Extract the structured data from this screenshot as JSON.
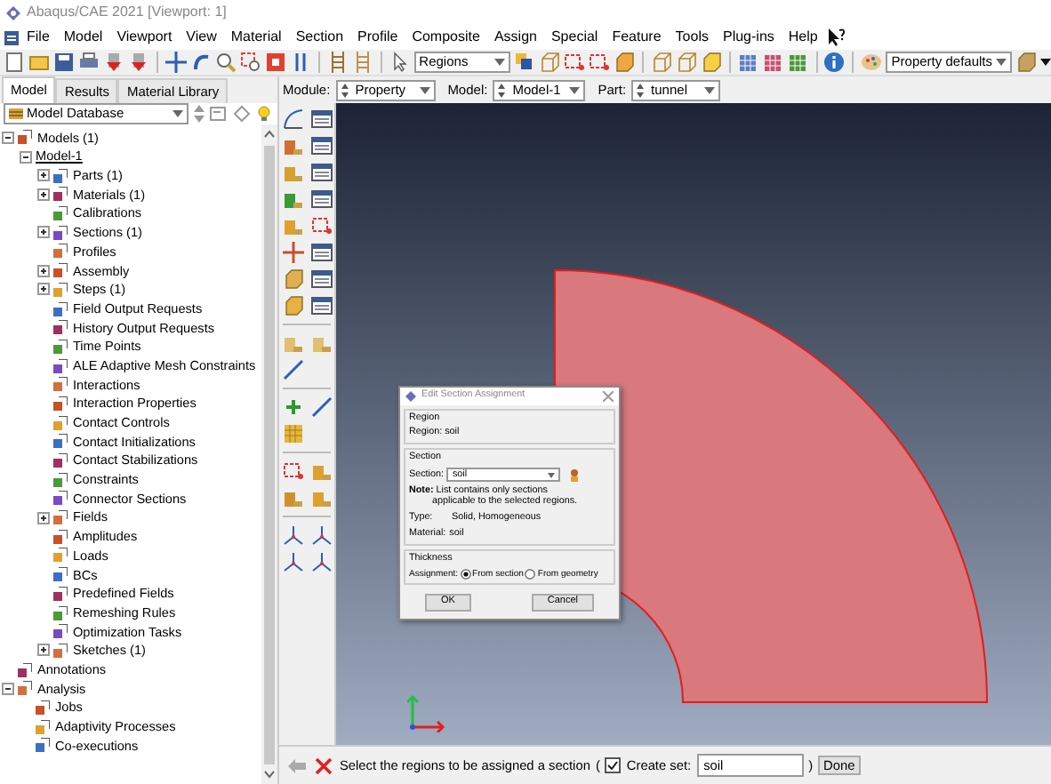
{
  "window": {
    "title": "Abaqus/CAE 2021 [Viewport: 1]"
  },
  "menu": [
    "File",
    "Model",
    "Viewport",
    "View",
    "Material",
    "Section",
    "Profile",
    "Composite",
    "Assign",
    "Special",
    "Feature",
    "Tools",
    "Plug-ins",
    "Help"
  ],
  "toolbar": {
    "selection_filter": "Regions",
    "display_defaults": "Property defaults"
  },
  "tabs": [
    {
      "label": "Model",
      "selected": true
    },
    {
      "label": "Results",
      "selected": false
    },
    {
      "label": "Material Library",
      "selected": false
    }
  ],
  "context_bar": [
    {
      "label": "Module:",
      "value": "Property"
    },
    {
      "label": "Model:",
      "value": "Model-1"
    },
    {
      "label": "Part:",
      "value": "tunnel"
    }
  ],
  "database": {
    "value": "Model Database"
  },
  "tree": [
    {
      "label": "Models (1)",
      "kind": "item",
      "expanded": true,
      "children": [
        {
          "label": "Model-1",
          "kind": "model",
          "expanded": true,
          "children": [
            {
              "label": "Parts (1)",
              "kind": "item",
              "expanded": false
            },
            {
              "label": "Materials (1)",
              "kind": "item",
              "expanded": false
            },
            {
              "label": "Calibrations",
              "kind": "item"
            },
            {
              "label": "Sections (1)",
              "kind": "item",
              "expanded": false
            },
            {
              "label": "Profiles",
              "kind": "item"
            },
            {
              "label": "Assembly",
              "kind": "item",
              "expanded": false
            },
            {
              "label": "Steps (1)",
              "kind": "item",
              "expanded": false
            },
            {
              "label": "Field Output Requests",
              "kind": "item"
            },
            {
              "label": "History Output Requests",
              "kind": "item"
            },
            {
              "label": "Time Points",
              "kind": "item"
            },
            {
              "label": "ALE Adaptive Mesh Constraints",
              "kind": "item"
            },
            {
              "label": "Interactions",
              "kind": "item"
            },
            {
              "label": "Interaction Properties",
              "kind": "item"
            },
            {
              "label": "Contact Controls",
              "kind": "item"
            },
            {
              "label": "Contact Initializations",
              "kind": "item"
            },
            {
              "label": "Contact Stabilizations",
              "kind": "item"
            },
            {
              "label": "Constraints",
              "kind": "item"
            },
            {
              "label": "Connector Sections",
              "kind": "item"
            },
            {
              "label": "Fields",
              "kind": "item",
              "expanded": false
            },
            {
              "label": "Amplitudes",
              "kind": "item"
            },
            {
              "label": "Loads",
              "kind": "item"
            },
            {
              "label": "BCs",
              "kind": "item"
            },
            {
              "label": "Predefined Fields",
              "kind": "item"
            },
            {
              "label": "Remeshing Rules",
              "kind": "item"
            },
            {
              "label": "Optimization Tasks",
              "kind": "item"
            },
            {
              "label": "Sketches (1)",
              "kind": "item",
              "expanded": false
            }
          ]
        }
      ]
    },
    {
      "label": "Annotations",
      "kind": "item"
    },
    {
      "label": "Analysis",
      "kind": "item",
      "expanded": true,
      "children": [
        {
          "label": "Jobs",
          "kind": "item"
        },
        {
          "label": "Adaptivity Processes",
          "kind": "item"
        },
        {
          "label": "Co-executions",
          "kind": "item"
        }
      ]
    }
  ],
  "dialog": {
    "title": "Edit Section Assignment",
    "region": {
      "heading": "Region",
      "text": "Region: soil"
    },
    "section": {
      "heading": "Section",
      "label": "Section:",
      "value": "soil",
      "note": "**Note:** List contains only sections",
      "note_2": "applicable to the selected regions.",
      "type_label": "Type:",
      "type": "Solid, Homogeneous",
      "material_label": "Material:",
      "material": "soil"
    },
    "thickness": {
      "heading": "Thickness",
      "label": "Assignment:",
      "options": [
        {
          "label": "From section",
          "selected": true
        },
        {
          "label": "From geometry",
          "selected": false
        }
      ]
    },
    "buttons": [
      "OK",
      "Cancel"
    ]
  },
  "prompt": {
    "text": "Select the regions to be assigned a section",
    "open": "(",
    "create_set": {
      "label": "Create set:",
      "checked": true
    },
    "set_name": "soil",
    "close": ")",
    "button": "Done"
  }
}
